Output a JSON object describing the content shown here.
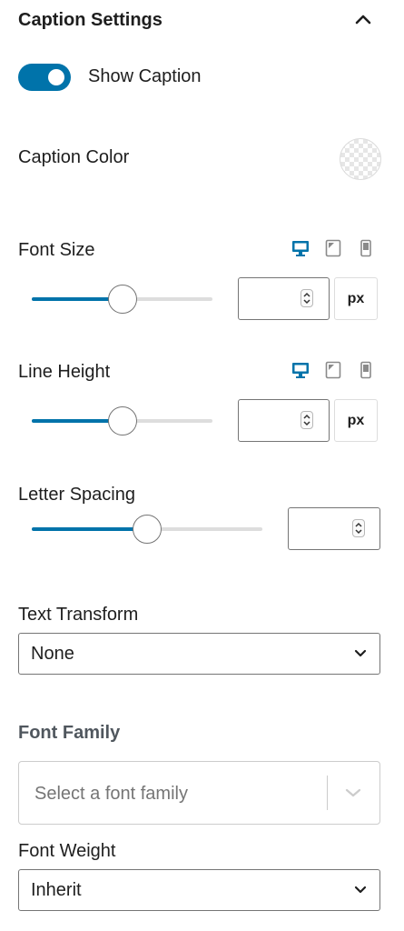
{
  "header": {
    "title": "Caption Settings",
    "collapse_icon": "chevron-up-icon"
  },
  "show_caption": {
    "label": "Show Caption",
    "enabled": true,
    "accent": "#0073aa"
  },
  "caption_color": {
    "label": "Caption Color",
    "value": "transparent"
  },
  "font_size": {
    "label": "Font Size",
    "devices": [
      "desktop-icon",
      "tablet-icon",
      "mobile-icon"
    ],
    "active_device": "desktop",
    "value": "",
    "unit": "px",
    "slider_fraction": 0.5
  },
  "line_height": {
    "label": "Line Height",
    "devices": [
      "desktop-icon",
      "tablet-icon",
      "mobile-icon"
    ],
    "active_device": "desktop",
    "value": "",
    "unit": "px",
    "slider_fraction": 0.5
  },
  "letter_spacing": {
    "label": "Letter Spacing",
    "value": "",
    "slider_fraction": 0.5
  },
  "text_transform": {
    "label": "Text Transform",
    "selected": "None"
  },
  "font_family": {
    "label": "Font Family",
    "placeholder": "Select a font family"
  },
  "font_weight": {
    "label": "Font Weight",
    "selected": "Inherit"
  }
}
